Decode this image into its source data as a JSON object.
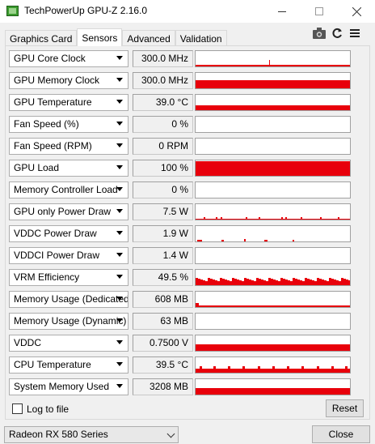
{
  "window": {
    "title": "TechPowerUp GPU-Z 2.16.0",
    "min_icon": "minimize-icon",
    "max_icon": "maximize-icon",
    "close_icon": "close-icon"
  },
  "tabs": [
    {
      "label": "Graphics Card",
      "active": false
    },
    {
      "label": "Sensors",
      "active": true
    },
    {
      "label": "Advanced",
      "active": false
    },
    {
      "label": "Validation",
      "active": false
    }
  ],
  "toolbar": {
    "camera_icon": "camera-icon",
    "refresh_icon": "refresh-icon",
    "menu_icon": "menu-icon"
  },
  "accent_color": "#e8000b",
  "sensors": [
    {
      "name": "GPU Core Clock",
      "value": "300.0 MHz",
      "graph": "spike",
      "level": 0.05
    },
    {
      "name": "GPU Memory Clock",
      "value": "300.0 MHz",
      "graph": "fill",
      "level": 0.55
    },
    {
      "name": "GPU Temperature",
      "value": "39.0 °C",
      "graph": "fill",
      "level": 0.3
    },
    {
      "name": "Fan Speed (%)",
      "value": "0 %",
      "graph": "none",
      "level": 0
    },
    {
      "name": "Fan Speed (RPM)",
      "value": "0 RPM",
      "graph": "none",
      "level": 0
    },
    {
      "name": "GPU Load",
      "value": "100 %",
      "graph": "fill",
      "level": 0.95
    },
    {
      "name": "Memory Controller Load",
      "value": "0 %",
      "graph": "none",
      "level": 0
    },
    {
      "name": "GPU only Power Draw",
      "value": "7.5 W",
      "graph": "sparse",
      "level": 0.08
    },
    {
      "name": "VDDC Power Draw",
      "value": "1.9 W",
      "graph": "dots",
      "level": 0.05
    },
    {
      "name": "VDDCI Power Draw",
      "value": "1.4 W",
      "graph": "none",
      "level": 0
    },
    {
      "name": "VRM Efficiency",
      "value": "49.5 %",
      "graph": "jagged",
      "level": 0.45
    },
    {
      "name": "Memory Usage (Dedicated)",
      "value": "608 MB",
      "graph": "thin",
      "level": 0.1
    },
    {
      "name": "Memory Usage (Dynamic)",
      "value": "63 MB",
      "graph": "none",
      "level": 0
    },
    {
      "name": "VDDC",
      "value": "0.7500 V",
      "graph": "fill",
      "level": 0.4
    },
    {
      "name": "CPU Temperature",
      "value": "39.5 °C",
      "graph": "bumpy",
      "level": 0.35
    },
    {
      "name": "System Memory Used",
      "value": "3208 MB",
      "graph": "fill",
      "level": 0.4
    }
  ],
  "footer": {
    "log_label": "Log to file",
    "log_checked": false,
    "reset_label": "Reset",
    "gpu_selected": "Radeon RX 580 Series",
    "close_label": "Close"
  }
}
